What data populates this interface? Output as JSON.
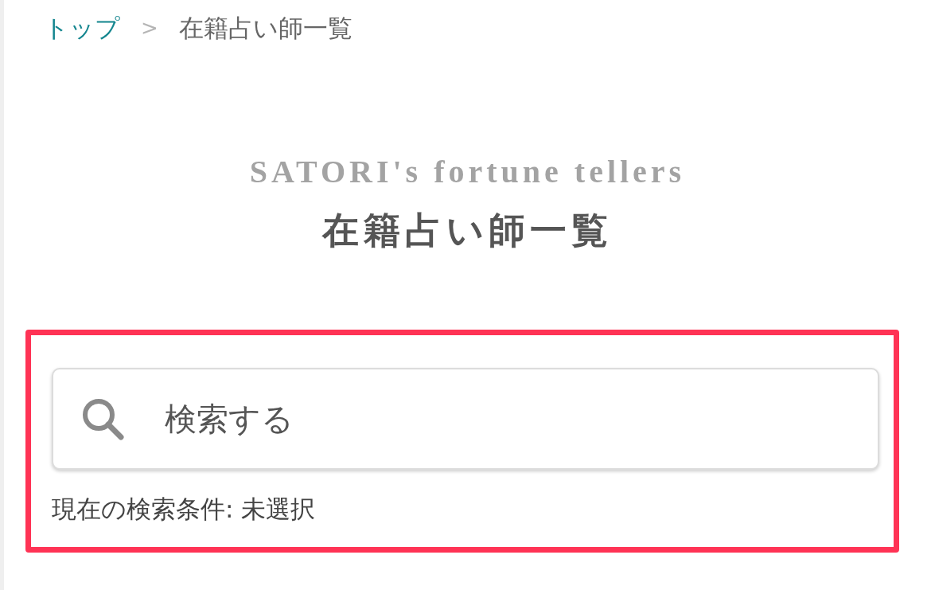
{
  "breadcrumb": [
    {
      "label": "トップ",
      "kind": "link"
    },
    {
      "label": "在籍占い師一覧",
      "kind": "current"
    }
  ],
  "breadcrumb_separator": ">",
  "subtitle": "SATORI's fortune tellers",
  "title": "在籍占い師一覧",
  "search": {
    "placeholder": "検索する",
    "condition": "現在の検索条件: 未選択",
    "highlighted": true
  }
}
